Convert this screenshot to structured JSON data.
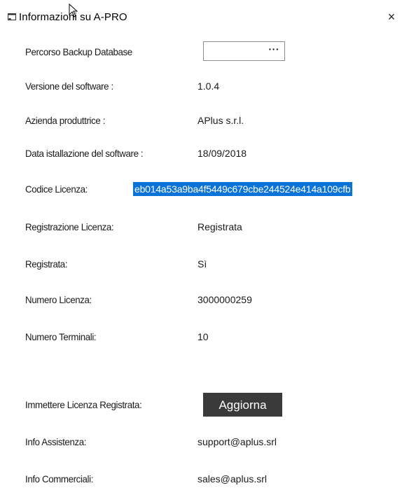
{
  "window": {
    "title": "Informazioni su A-PRO",
    "close_glyph": "×"
  },
  "backup": {
    "label": "Percorso Backup Database",
    "value": "",
    "browse_label": "···"
  },
  "info": [
    {
      "label": "Versione del software :",
      "value": "1.0.4"
    },
    {
      "label": "Azienda produttrice :",
      "value": "APlus s.r.l."
    },
    {
      "label": "Data istallazione del software :",
      "value": "18/09/2018"
    },
    {
      "label": "Codice Licenza:",
      "value": "eb014a53a9ba4f5449c679cbe244524e414a109cfb"
    },
    {
      "label": "Registrazione Licenza:",
      "value": "Registrata"
    },
    {
      "label": "Registrata:",
      "value": "Sì"
    },
    {
      "label": "Numero Licenza:",
      "value": "3000000259"
    },
    {
      "label": "Numero Terminali:",
      "value": "10"
    }
  ],
  "update": {
    "label": "Immettere Licenza Registrata:",
    "button_label": "Aggiorna"
  },
  "support": {
    "label": "Info Assistenza:",
    "value": "support@aplus.srl"
  },
  "sales": {
    "label": "Info Commerciali:",
    "value": "sales@aplus.srl"
  },
  "colors": {
    "selection": "#0a73d9",
    "button": "#3a3a3a"
  },
  "icons": [
    "app-window-icon",
    "mouse-cursor-icon",
    "close-icon"
  ]
}
